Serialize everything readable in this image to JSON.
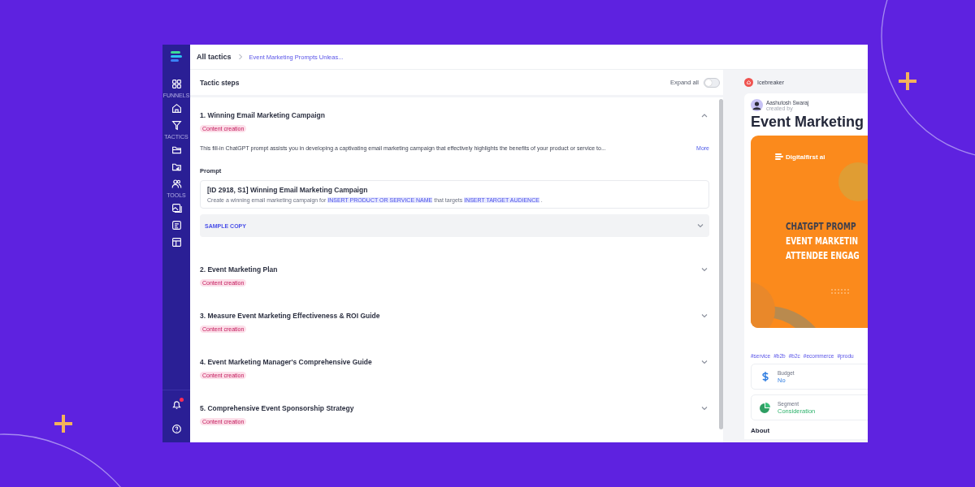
{
  "sidebar": {
    "section_labels": [
      "FUNNELS",
      "TACTICS",
      "TOOLS"
    ],
    "notification_badge": true
  },
  "breadcrumb": [
    {
      "label": "All tactics",
      "current": false
    },
    {
      "label": "Event Marketing Prompts Unleas...",
      "current": true
    }
  ],
  "panel": {
    "title": "Tactic steps",
    "expand_all": {
      "label": "Expand all",
      "on": false
    }
  },
  "steps": [
    {
      "title": "1. Winning Email Marketing Campaign",
      "tag": "Content creation",
      "expanded": true,
      "description": "This fill-in ChatGPT prompt assists you in developing a captivating email marketing campaign that effectively highlights the benefits of your product or service to...",
      "more": "More",
      "prompt_label": "Prompt",
      "prompt_title": "[ID 2918, S1] Winning Email Marketing Campaign",
      "prompt_parts": [
        {
          "text": "Create a winning email marketing campaign for ",
          "kind": "plain"
        },
        {
          "text": "INSERT PRODUCT OR SERVICE NAME",
          "kind": "placeholder"
        },
        {
          "text": " that targets ",
          "kind": "plain"
        },
        {
          "text": "INSERT TARGET AUDIENCE",
          "kind": "placeholder"
        },
        {
          "text": " .",
          "kind": "plain"
        }
      ],
      "sample_copy": "SAMPLE COPY"
    },
    {
      "title": "2. Event Marketing Plan",
      "tag": "Content creation",
      "expanded": false
    },
    {
      "title": "3. Measure Event Marketing Effectiveness & ROI Guide",
      "tag": "Content creation",
      "expanded": false
    },
    {
      "title": "4. Event Marketing Manager's Comprehensive Guide",
      "tag": "Content creation",
      "expanded": false
    },
    {
      "title": "5. Comprehensive Event Sponsorship Strategy",
      "tag": "Content creation",
      "expanded": false
    }
  ],
  "detail": {
    "category": "Icebreaker",
    "author": "Aashutosh Swaraj",
    "author_caption": "created by",
    "title": "Event Marketing",
    "cover": {
      "brand": "Digitalfirst ai",
      "lines": [
        "CHATGPT PROMP",
        "EVENT MARKETIN",
        "ATTENDEE ENGAG"
      ]
    },
    "tags": [
      "#service",
      "#b2b",
      "#b2c",
      "#ecommerce",
      "#produ"
    ],
    "facts": [
      {
        "kind": "budget",
        "label": "Budget",
        "value": "No"
      },
      {
        "kind": "segment",
        "label": "Segment",
        "value": "Consideration"
      }
    ],
    "about": "About"
  }
}
